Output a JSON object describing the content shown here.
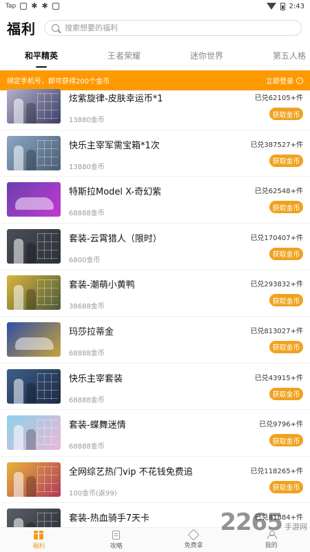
{
  "status_bar": {
    "left_label": "Tap",
    "time": "2:43"
  },
  "header": {
    "title": "福利",
    "search_placeholder": "搜索想要的福利"
  },
  "tabs": [
    {
      "label": "和平精英",
      "active": true
    },
    {
      "label": "王者荣耀",
      "active": false
    },
    {
      "label": "迷你世界",
      "active": false
    },
    {
      "label": "第五人格",
      "active": false
    }
  ],
  "banner": {
    "text": "绑定手机号，即可获得200个金币",
    "action": "立即登录"
  },
  "items": [
    {
      "title": "炫紫旋律-皮肤幸运币*1",
      "price": "13880金币",
      "redeemed": "已兑62105+件",
      "button": "获取金币",
      "colors": [
        "#b6b0c8",
        "#3a3f66"
      ],
      "style": "char"
    },
    {
      "title": "快乐主宰军需宝箱*1次",
      "price": "13880金币",
      "redeemed": "已兑387527+件",
      "button": "获取金币",
      "colors": [
        "#8aa7c4",
        "#4b5d74"
      ],
      "style": "char"
    },
    {
      "title": "特斯拉Model X-奇幻紫",
      "price": "68888金币",
      "redeemed": "已兑62548+件",
      "button": "获取金币",
      "colors": [
        "#6b3fb0",
        "#c03ad0"
      ],
      "style": "car"
    },
    {
      "title": "套装-云霄猎人（限时）",
      "price": "6800金币",
      "redeemed": "已兑170407+件",
      "button": "获取金币",
      "colors": [
        "#4a4f58",
        "#2c3038"
      ],
      "style": "char"
    },
    {
      "title": "套装-潮萌小黄鸭",
      "price": "38688金币",
      "redeemed": "已兑293832+件",
      "button": "获取金币",
      "colors": [
        "#d8b43a",
        "#4a5a3a"
      ],
      "style": "char"
    },
    {
      "title": "玛莎拉蒂金",
      "price": "68888金币",
      "redeemed": "已兑813027+件",
      "button": "获取金币",
      "colors": [
        "#2f4fa8",
        "#c9a23a"
      ],
      "style": "car"
    },
    {
      "title": "快乐主宰套装",
      "price": "68888金币",
      "redeemed": "已兑43915+件",
      "button": "获取金币",
      "colors": [
        "#3d5e8a",
        "#1e2a44"
      ],
      "style": "char"
    },
    {
      "title": "套装-蝶舞迷情",
      "price": "68888金币",
      "redeemed": "已兑9796+件",
      "button": "获取金币",
      "colors": [
        "#8fd0e8",
        "#e9b7d8"
      ],
      "style": "char"
    },
    {
      "title": "全网综艺热门vip 不花钱免费追",
      "price": "100金币(返99)",
      "redeemed": "已兑118265+件",
      "button": "获取金币",
      "colors": [
        "#e8b23a",
        "#b03a5a"
      ],
      "style": "char"
    },
    {
      "title": "套装-热血骑手7天卡",
      "price": "",
      "redeemed": "已兑81884+件",
      "button": "获取金币",
      "colors": [
        "#5a5f68",
        "#2a2e34"
      ],
      "style": "char"
    }
  ],
  "bottom_nav": [
    {
      "label": "福利",
      "icon": "gift-icon",
      "active": true
    },
    {
      "label": "攻略",
      "icon": "doc-icon",
      "active": false
    },
    {
      "label": "免费拿",
      "icon": "diamond-icon",
      "active": false
    },
    {
      "label": "我的",
      "icon": "user-icon",
      "active": false
    }
  ],
  "watermark": {
    "number": "2265",
    "suffix": "手游网"
  },
  "accent_color": "#ff9900"
}
